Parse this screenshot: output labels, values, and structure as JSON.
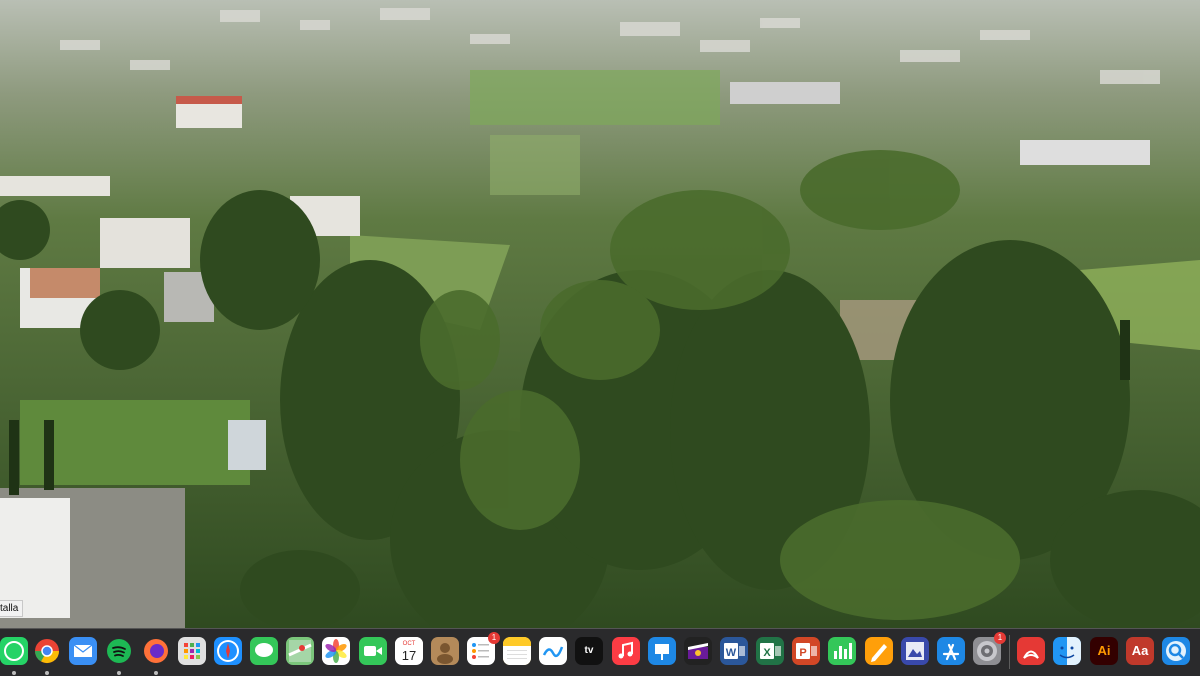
{
  "viewer": {
    "tooltip_text": "talla"
  },
  "dock": {
    "items": [
      {
        "name": "whatsapp",
        "icon": "whatsapp-icon",
        "color": "#25d366"
      },
      {
        "name": "chrome",
        "icon": "chrome-icon",
        "color": "#fbbc05"
      },
      {
        "name": "mail",
        "icon": "mail-icon",
        "color": "#3a8ff4"
      },
      {
        "name": "spotify",
        "icon": "spotify-icon",
        "color": "#1db954"
      },
      {
        "name": "firefox",
        "icon": "firefox-icon",
        "color": "#ff7139"
      },
      {
        "name": "launchpad",
        "icon": "launchpad-icon",
        "color": "#e0e0e0"
      },
      {
        "name": "safari",
        "icon": "safari-icon",
        "color": "#1e90ff"
      },
      {
        "name": "messages",
        "icon": "messages-icon",
        "color": "#34c759"
      },
      {
        "name": "maps",
        "icon": "maps-icon",
        "color": "#7bc67b"
      },
      {
        "name": "photos",
        "icon": "photos-icon",
        "color": "#ffffff"
      },
      {
        "name": "facetime",
        "icon": "facetime-icon",
        "color": "#34c759"
      },
      {
        "name": "calendar",
        "icon": "calendar-icon",
        "color": "#ffffff",
        "month": "OCT",
        "day": "17"
      },
      {
        "name": "contacts",
        "icon": "contacts-icon",
        "color": "#b48a5a"
      },
      {
        "name": "reminders",
        "icon": "reminders-icon",
        "color": "#ffffff",
        "badge": "1"
      },
      {
        "name": "notes",
        "icon": "notes-icon",
        "color": "#ffd54f"
      },
      {
        "name": "freeform",
        "icon": "freeform-icon",
        "color": "#ffffff"
      },
      {
        "name": "tv",
        "icon": "apple-tv-icon",
        "color": "#111111",
        "label": "tv"
      },
      {
        "name": "music",
        "icon": "music-icon",
        "color": "#fc3c44"
      },
      {
        "name": "keynote",
        "icon": "keynote-icon",
        "color": "#1e88e5"
      },
      {
        "name": "imovie",
        "icon": "imovie-icon",
        "color": "#222222"
      },
      {
        "name": "word",
        "icon": "word-icon",
        "color": "#2b579a"
      },
      {
        "name": "excel",
        "icon": "excel-icon",
        "color": "#217346"
      },
      {
        "name": "powerpoint",
        "icon": "powerpoint-icon",
        "color": "#d24726"
      },
      {
        "name": "numbers",
        "icon": "numbers-icon",
        "color": "#34c759"
      },
      {
        "name": "pages",
        "icon": "pages-icon",
        "color": "#ff9f0a"
      },
      {
        "name": "preview",
        "icon": "preview-icon",
        "color": "#3949ab"
      },
      {
        "name": "app-store",
        "icon": "app-store-icon",
        "color": "#1e88e5"
      },
      {
        "name": "system-settings",
        "icon": "gear-icon",
        "color": "#8e8e93",
        "badge": "1"
      },
      {
        "name": "acrobat",
        "icon": "acrobat-icon",
        "color": "#e53935"
      },
      {
        "name": "finder",
        "icon": "finder-icon",
        "color": "#2196f3"
      },
      {
        "name": "illustrator",
        "icon": "illustrator-icon",
        "color": "#330000",
        "label": "Ai"
      },
      {
        "name": "dictionary",
        "icon": "dictionary-icon",
        "color": "#c0392b",
        "label": "Aa"
      },
      {
        "name": "quicktime",
        "icon": "quicktime-icon",
        "color": "#1e88e5"
      }
    ]
  }
}
